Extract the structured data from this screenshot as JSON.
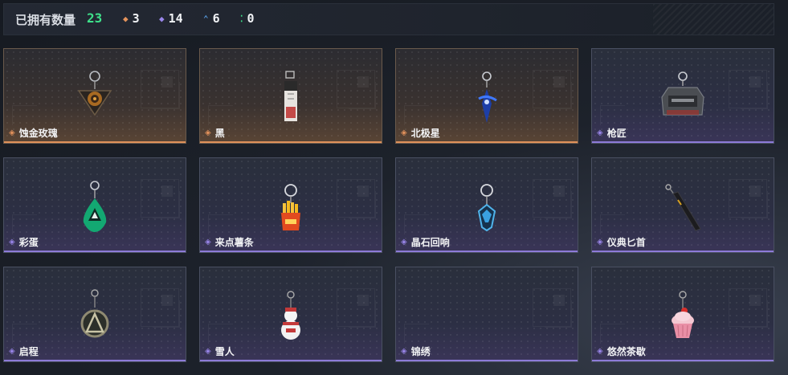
{
  "header": {
    "title": "已拥有数量",
    "total": "23",
    "stats": [
      {
        "icon": "gold-diamond-icon",
        "color": "#e5935c",
        "symbol": "◆",
        "value": "3"
      },
      {
        "icon": "purple-diamond-icon",
        "color": "#9a86ea",
        "symbol": "◆",
        "value": "14"
      },
      {
        "icon": "blue-chevron-icon",
        "color": "#5aa2e8",
        "symbol": "⌃",
        "value": "6"
      },
      {
        "icon": "green-dots-icon",
        "color": "#3ee08a",
        "symbol": "⁚",
        "value": "0"
      }
    ]
  },
  "items": [
    {
      "name": "蚀金玫瑰",
      "rarity": "gold",
      "icon": "rose-charm-icon"
    },
    {
      "name": "黑",
      "rarity": "gold",
      "icon": "black-tag-charm-icon"
    },
    {
      "name": "北极星",
      "rarity": "gold",
      "icon": "polaris-charm-icon"
    },
    {
      "name": "枪匠",
      "rarity": "purple",
      "icon": "gunsmith-helmet-charm-icon"
    },
    {
      "name": "彩蛋",
      "rarity": "purple",
      "icon": "easter-egg-charm-icon"
    },
    {
      "name": "来点薯条",
      "rarity": "purple",
      "icon": "fries-charm-icon"
    },
    {
      "name": "晶石回响",
      "rarity": "purple",
      "icon": "crystal-echo-charm-icon"
    },
    {
      "name": "仪典匕首",
      "rarity": "purple",
      "icon": "ceremonial-dagger-charm-icon"
    },
    {
      "name": "启程",
      "rarity": "purple",
      "icon": "departure-medal-charm-icon"
    },
    {
      "name": "雪人",
      "rarity": "purple",
      "icon": "snowman-charm-icon"
    },
    {
      "name": "锦绣",
      "rarity": "purple",
      "icon": "empty-slot-icon"
    },
    {
      "name": "悠然茶歇",
      "rarity": "purple",
      "icon": "cupcake-charm-icon"
    }
  ]
}
